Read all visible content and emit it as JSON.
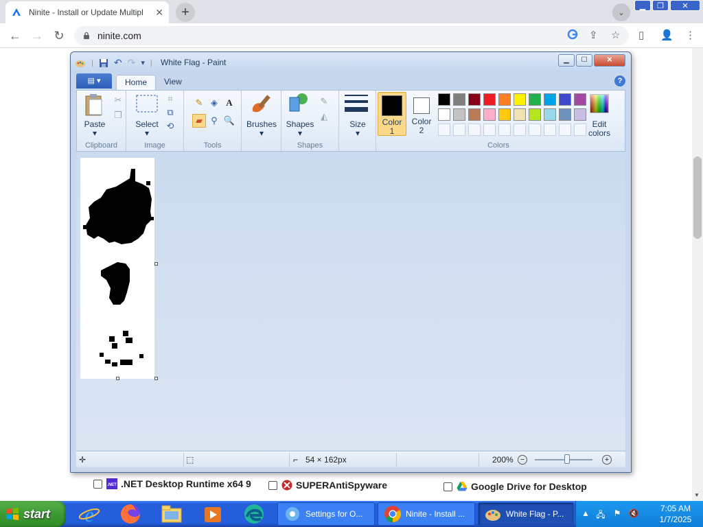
{
  "browser": {
    "tab_title": "Ninite - Install or Update Multipl",
    "url": "ninite.com"
  },
  "ninite_apps": [
    {
      "name": ".NET Desktop Runtime x64 9",
      "checked": false
    },
    {
      "name": "SUPERAntiSpyware",
      "checked": false
    },
    {
      "name": "Google Drive for Desktop",
      "checked": false
    }
  ],
  "paint": {
    "title": "White Flag - Paint",
    "tabs": {
      "home": "Home",
      "view": "View"
    },
    "groups": {
      "clipboard": "Clipboard",
      "image": "Image",
      "tools": "Tools",
      "shapes": "Shapes",
      "colors": "Colors"
    },
    "buttons": {
      "paste": "Paste",
      "select": "Select",
      "brushes": "Brushes",
      "shapes": "Shapes",
      "size": "Size",
      "color1": "Color",
      "color1_num": "1",
      "color2": "Color",
      "color2_num": "2",
      "edit_colors_1": "Edit",
      "edit_colors_2": "colors"
    },
    "palette_row1": [
      "#000000",
      "#7f7f7f",
      "#880015",
      "#ed1c24",
      "#ff7f27",
      "#fff200",
      "#22b14c",
      "#00a2e8",
      "#3f48cc",
      "#a349a4"
    ],
    "palette_row2": [
      "#ffffff",
      "#c3c3c3",
      "#b97a57",
      "#ffaec9",
      "#ffc90e",
      "#efe4b0",
      "#b5e61d",
      "#99d9ea",
      "#7092be",
      "#c8bfe7"
    ],
    "status": {
      "dimensions": "54 × 162px",
      "zoom": "200%"
    }
  },
  "taskbar": {
    "start": "start",
    "tasks": [
      {
        "label": "Settings for O..."
      },
      {
        "label": "Ninite - Install ..."
      },
      {
        "label": "White Flag - P..."
      }
    ],
    "time": "7:05 AM",
    "date": "1/7/2025"
  }
}
